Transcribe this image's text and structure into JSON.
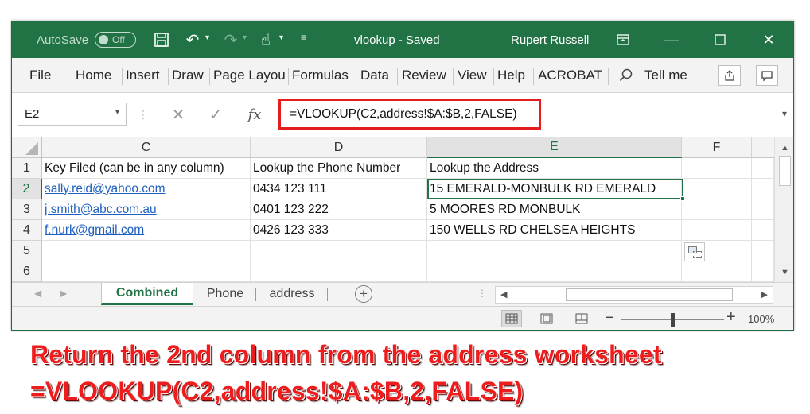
{
  "titlebar": {
    "autosave_label": "AutoSave",
    "autosave_state": "Off",
    "doc_title": "vlookup  -  Saved",
    "user_name": "Rupert Russell"
  },
  "ribbon": {
    "tabs": [
      "File",
      "Home",
      "Insert",
      "Draw",
      "Page Layout",
      "Formulas",
      "Data",
      "Review",
      "View",
      "Help",
      "ACROBAT"
    ],
    "tell_me": "Tell me"
  },
  "formula_bar": {
    "name_box": "E2",
    "formula": "=VLOOKUP(C2,address!$A:$B,2,FALSE)",
    "fx_label": "fx"
  },
  "sheet": {
    "columns": [
      "C",
      "D",
      "E",
      "F"
    ],
    "selected_column": "E",
    "rows": [
      {
        "num": "1",
        "C": "Key Filed (can be in any column)",
        "D": "Lookup the Phone Number",
        "E": "Lookup the Address"
      },
      {
        "num": "2",
        "C": "sally.reid@yahoo.com",
        "D": "0434 123 111",
        "E": "15 EMERALD-MONBULK RD EMERALD"
      },
      {
        "num": "3",
        "C": "j.smith@abc.com.au",
        "D": "0401 123 222",
        "E": "5 MOORES RD MONBULK"
      },
      {
        "num": "4",
        "C": "f.nurk@gmail.com",
        "D": "0426 123 333",
        "E": "150 WELLS RD CHELSEA HEIGHTS"
      },
      {
        "num": "5",
        "C": "",
        "D": "",
        "E": ""
      },
      {
        "num": "6",
        "C": "",
        "D": "",
        "E": ""
      }
    ],
    "selected_cell": "E2"
  },
  "sheet_tabs": [
    "Combined",
    "Phone",
    "address"
  ],
  "active_sheet": "Combined",
  "status": {
    "zoom": "100%"
  },
  "caption": {
    "line1": "Return the 2nd column from the address worksheet",
    "line2": "=VLOOKUP(C2,address!$A:$B,2,FALSE)"
  },
  "colors": {
    "excel_green": "#217346",
    "highlight_red": "#e41e1e",
    "link_blue": "#1f5fbf"
  }
}
